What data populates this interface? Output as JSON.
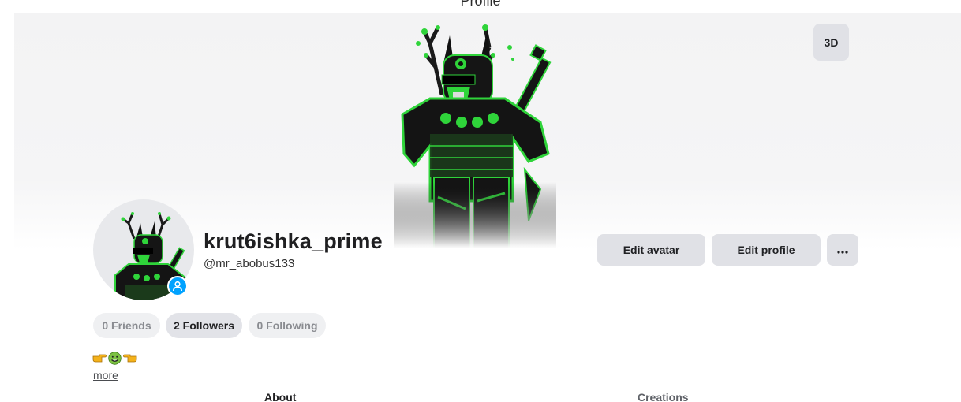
{
  "page": {
    "heading": "Profile"
  },
  "hero": {
    "view_toggle_label": "3D"
  },
  "profile": {
    "display_name": "krut6ishka_prime",
    "username": "@mr_abobus133"
  },
  "actions": {
    "edit_avatar_label": "Edit avatar",
    "edit_profile_label": "Edit profile",
    "more_label": "···"
  },
  "stats": {
    "friends": "0 Friends",
    "followers": "2 Followers",
    "following": "0 Following"
  },
  "bio": {
    "emojis": [
      "pointing-right-emoji",
      "nauseated-face-emoji",
      "pointing-left-emoji"
    ],
    "more_label": "more"
  },
  "tabs": [
    {
      "label": "About",
      "active": true
    },
    {
      "label": "Creations",
      "active": false
    }
  ],
  "colors": {
    "accent_green": "#2fd43a",
    "presence_blue": "#00a2ff",
    "button_bg": "#e0e1e6"
  }
}
